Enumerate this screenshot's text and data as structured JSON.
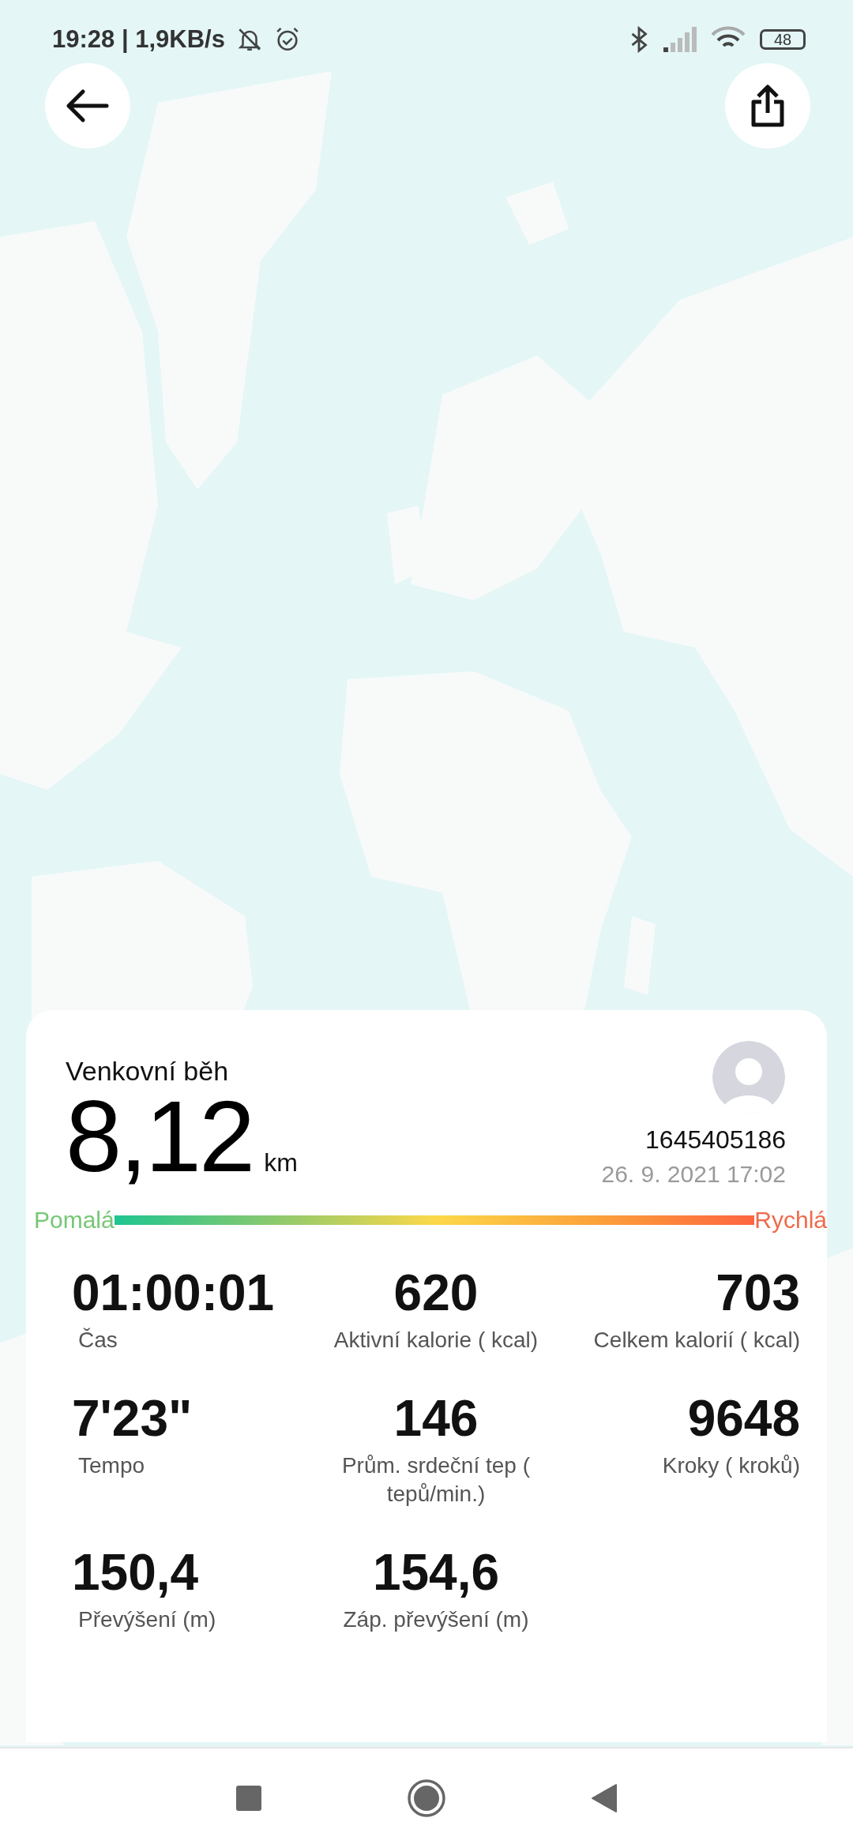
{
  "status_bar": {
    "time": "19:28 | 1,9KB/s",
    "battery": "48"
  },
  "workout": {
    "title": "Venkovní běh",
    "distance": "8,12",
    "unit": "km",
    "user_id": "1645405186",
    "datetime": "26. 9. 2021 17:02"
  },
  "pace_scale": {
    "slow": "Pomalá",
    "fast": "Rychlá"
  },
  "stats": [
    {
      "value": "01:00:01",
      "label": "Čas"
    },
    {
      "value": "620",
      "label": "Aktivní kalorie ( kcal)"
    },
    {
      "value": "703",
      "label": "Celkem kalorií ( kcal)"
    },
    {
      "value": "7'23\"",
      "label": "Tempo"
    },
    {
      "value": "146",
      "label": "Prům. srdeční tep ( tepů/min.)"
    },
    {
      "value": "9648",
      "label": "Kroky ( kroků)"
    },
    {
      "value": "150,4",
      "label": "Převýšení (m)"
    },
    {
      "value": "154,6",
      "label": "Záp. převýšení (m)"
    }
  ]
}
